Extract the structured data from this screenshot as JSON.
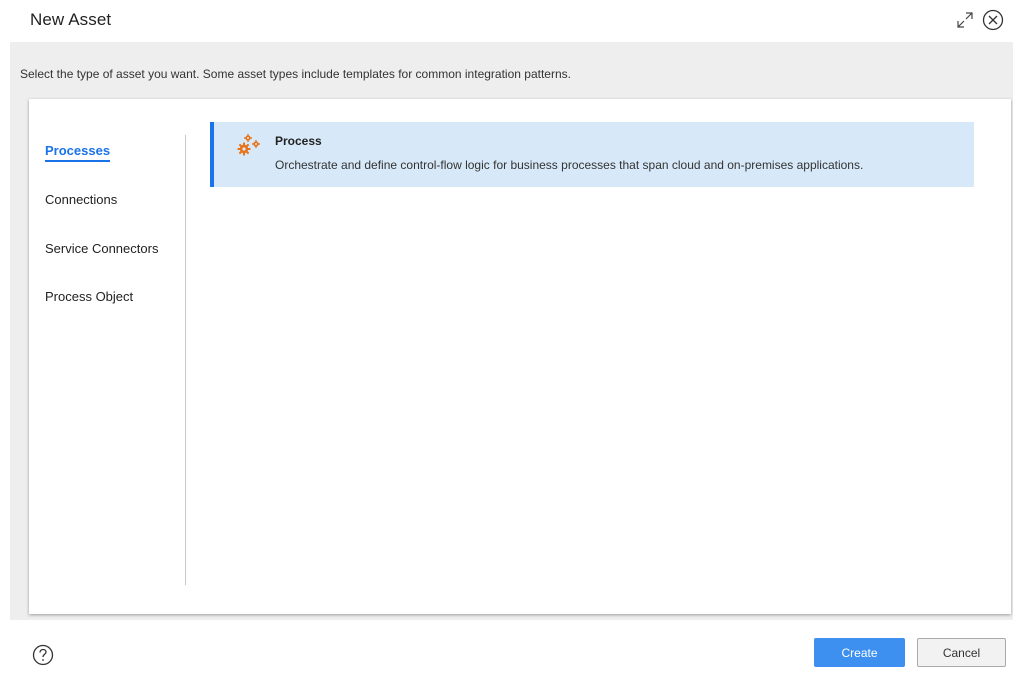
{
  "dialog": {
    "title": "New Asset",
    "instruction": "Select the type of asset you want. Some asset types include templates for common integration patterns."
  },
  "categories": [
    {
      "label": "Processes",
      "active": true
    },
    {
      "label": "Connections",
      "active": false
    },
    {
      "label": "Service Connectors",
      "active": false
    },
    {
      "label": "Process Object",
      "active": false
    }
  ],
  "assets": [
    {
      "name": "Process",
      "description": "Orchestrate and define control-flow logic for business processes that span cloud and on-premises applications.",
      "icon": "gears-icon",
      "selected": true
    }
  ],
  "footer": {
    "create_label": "Create",
    "cancel_label": "Cancel"
  },
  "icons": {
    "expand": "expand-icon",
    "close": "close-icon",
    "help": "help-icon"
  },
  "colors": {
    "accent": "#1a73e8",
    "create_button": "#3d8ff0",
    "selected_card": "#d7e9f8",
    "gear": "#e8731a"
  }
}
